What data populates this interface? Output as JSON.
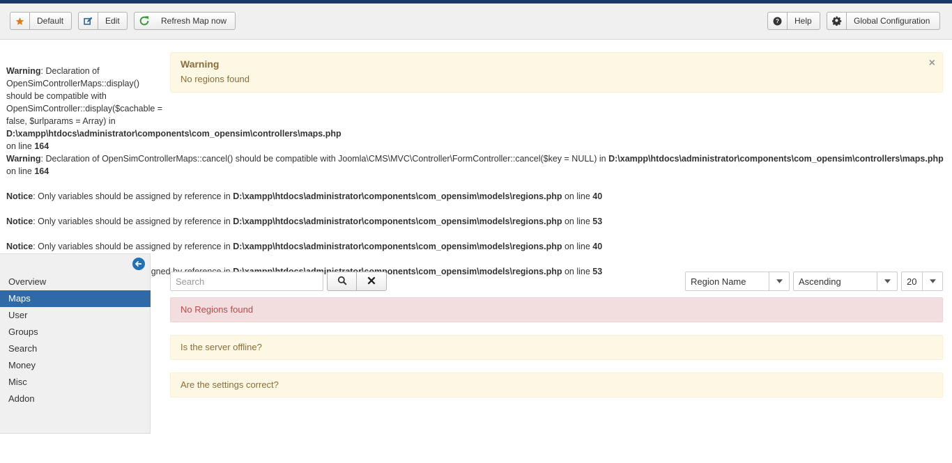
{
  "colors": {
    "top_bar": "#1a3867",
    "sidebar_active": "#2f6aa7",
    "warning_bg": "#fcf8e3",
    "error_bg": "#f2dede",
    "star": "#e07b16",
    "refresh": "#3a9a3a"
  },
  "toolbar": {
    "default_label": "Default",
    "edit_label": "Edit",
    "refresh_label": "Refresh Map now",
    "help_label": "Help",
    "global_config_label": "Global Configuration",
    "icons": [
      "star-icon",
      "edit-icon",
      "refresh-icon",
      "question-icon",
      "gear-icon"
    ]
  },
  "alert_warning": {
    "heading": "Warning",
    "text": "No regions found",
    "close": "×"
  },
  "php_messages": [
    {
      "type": "Warning",
      "text": ": Declaration of OpenSimControllerMaps::display() should be compatible with OpenSimController::display($cachable = false, $urlparams = Array) in ",
      "file": "D:\\xampp\\htdocs\\administrator\\components\\com_opensim\\controllers\\maps.php",
      "online": " on line ",
      "line": "164"
    },
    {
      "type": "Warning",
      "text": ": Declaration of OpenSimControllerMaps::cancel() should be compatible with Joomla\\CMS\\MVC\\Controller\\FormController::cancel($key = NULL) in ",
      "file": "D:\\xampp\\htdocs\\administrator\\components\\com_opensim\\controllers\\maps.php",
      "online": " on line ",
      "line": "164"
    },
    {
      "type": "Notice",
      "text": ": Only variables should be assigned by reference in ",
      "file": "D:\\xampp\\htdocs\\administrator\\components\\com_opensim\\models\\regions.php",
      "online": " on line ",
      "line": "40"
    },
    {
      "type": "Notice",
      "text": ": Only variables should be assigned by reference in ",
      "file": "D:\\xampp\\htdocs\\administrator\\components\\com_opensim\\models\\regions.php",
      "online": " on line ",
      "line": "53"
    },
    {
      "type": "Notice",
      "text": ": Only variables should be assigned by reference in ",
      "file": "D:\\xampp\\htdocs\\administrator\\components\\com_opensim\\models\\regions.php",
      "online": " on line ",
      "line": "40"
    },
    {
      "type": "Notice",
      "text": ": Only variables should be assigned by reference in ",
      "file": "D:\\xampp\\htdocs\\administrator\\components\\com_opensim\\models\\regions.php",
      "online": " on line ",
      "line": "53"
    }
  ],
  "sidebar": {
    "toggle_icon": "arrow-left-circle-icon",
    "items": [
      {
        "label": "Overview"
      },
      {
        "label": "Maps",
        "active": true
      },
      {
        "label": "User"
      },
      {
        "label": "Groups"
      },
      {
        "label": "Search"
      },
      {
        "label": "Money"
      },
      {
        "label": "Misc"
      },
      {
        "label": "Addon"
      }
    ]
  },
  "filters": {
    "search_placeholder": "Search",
    "search_value": "",
    "sort_field": "Region Name",
    "sort_order": "Ascending",
    "limit": "20"
  },
  "results": {
    "error_text": "No Regions found",
    "hint_offline": "Is the server offline?",
    "hint_settings": "Are the settings correct?"
  }
}
